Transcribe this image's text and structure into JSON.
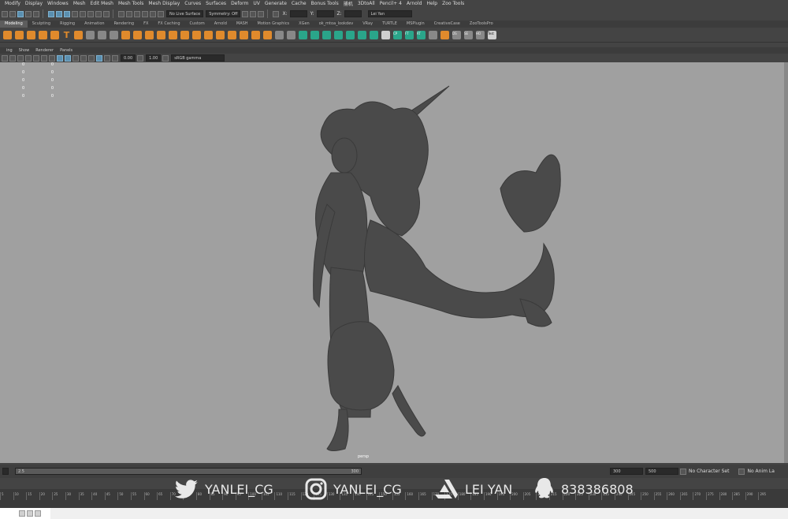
{
  "menubar": [
    "Modify",
    "Display",
    "Windows",
    "Mesh",
    "Edit Mesh",
    "Mesh Tools",
    "Mesh Display",
    "Curves",
    "Surfaces",
    "Deform",
    "UV",
    "Generate",
    "Cache",
    "Bonus Tools",
    "捕机",
    "3DtoAll",
    "Pencil+ 4",
    "Arnold",
    "Help",
    "Zoo Tools"
  ],
  "statusline": {
    "live_surface": "No Live Surface",
    "symmetry": "Symmetry: Off",
    "x_label": "X:",
    "y_label": "Y:",
    "z_label": "Z:",
    "user": "Lei Yan"
  },
  "shelf_tabs": [
    "Modeling",
    "Sculpting",
    "Rigging",
    "Animation",
    "Rendering",
    "FX",
    "FX Caching",
    "Custom",
    "Arnold",
    "MASH",
    "Motion Graphics",
    "XGen",
    "ok_mtoa_lookdev",
    "VRay",
    "TURTLE",
    "MSPlugin",
    "CreativeCase",
    "ZooToolsPro"
  ],
  "active_shelf_tab": "Modeling",
  "shelf_icon_labels": {
    "cp": "CP",
    "ft": "FT",
    "rt": "RT",
    "ds": "DS",
    "se": "SE",
    "ho": "HO",
    "test": "Test"
  },
  "panel_menu": [
    "ing",
    "Show",
    "Renderer",
    "Panels"
  ],
  "panel_toolbar": {
    "exposure": "0.00",
    "gamma": "1.00",
    "colorspace": "sRGB gamma"
  },
  "hud_values": [
    [
      "0",
      "0"
    ],
    [
      "0",
      "0"
    ],
    [
      "0",
      "0"
    ],
    [
      "0",
      "0"
    ],
    [
      "0",
      "0"
    ]
  ],
  "camera_name": "persp",
  "range": {
    "start": "2.5",
    "end": "300",
    "anim_end": "300",
    "end2": "500",
    "character_set": "No Character Set",
    "anim_layer": "No Anim La"
  },
  "ruler_ticks": [
    "5",
    "10",
    "15",
    "20",
    "25",
    "30",
    "35",
    "40",
    "45",
    "50",
    "55",
    "60",
    "65",
    "70",
    "75",
    "80",
    "85",
    "90",
    "95",
    "100",
    "105",
    "110",
    "115",
    "120",
    "125",
    "130",
    "135",
    "140",
    "145",
    "150",
    "155",
    "160",
    "165",
    "170",
    "175",
    "180",
    "185",
    "190",
    "195",
    "200",
    "205",
    "210",
    "215",
    "220",
    "225",
    "230",
    "235",
    "240",
    "245",
    "250",
    "255",
    "260",
    "265",
    "270",
    "275",
    "280",
    "285",
    "290",
    "295"
  ],
  "watermarks": {
    "twitter": "YANLEI_CG",
    "instagram": "YANLEI_CG",
    "artstation": "LEI YAN",
    "qq": "838386808"
  },
  "colors": {
    "viewport_bg": "#a0a0a0",
    "ui_bg": "#444444",
    "accent_orange": "#e08a2c",
    "accent_teal": "#2aa58a",
    "model_grey": "#4a4a4a"
  }
}
